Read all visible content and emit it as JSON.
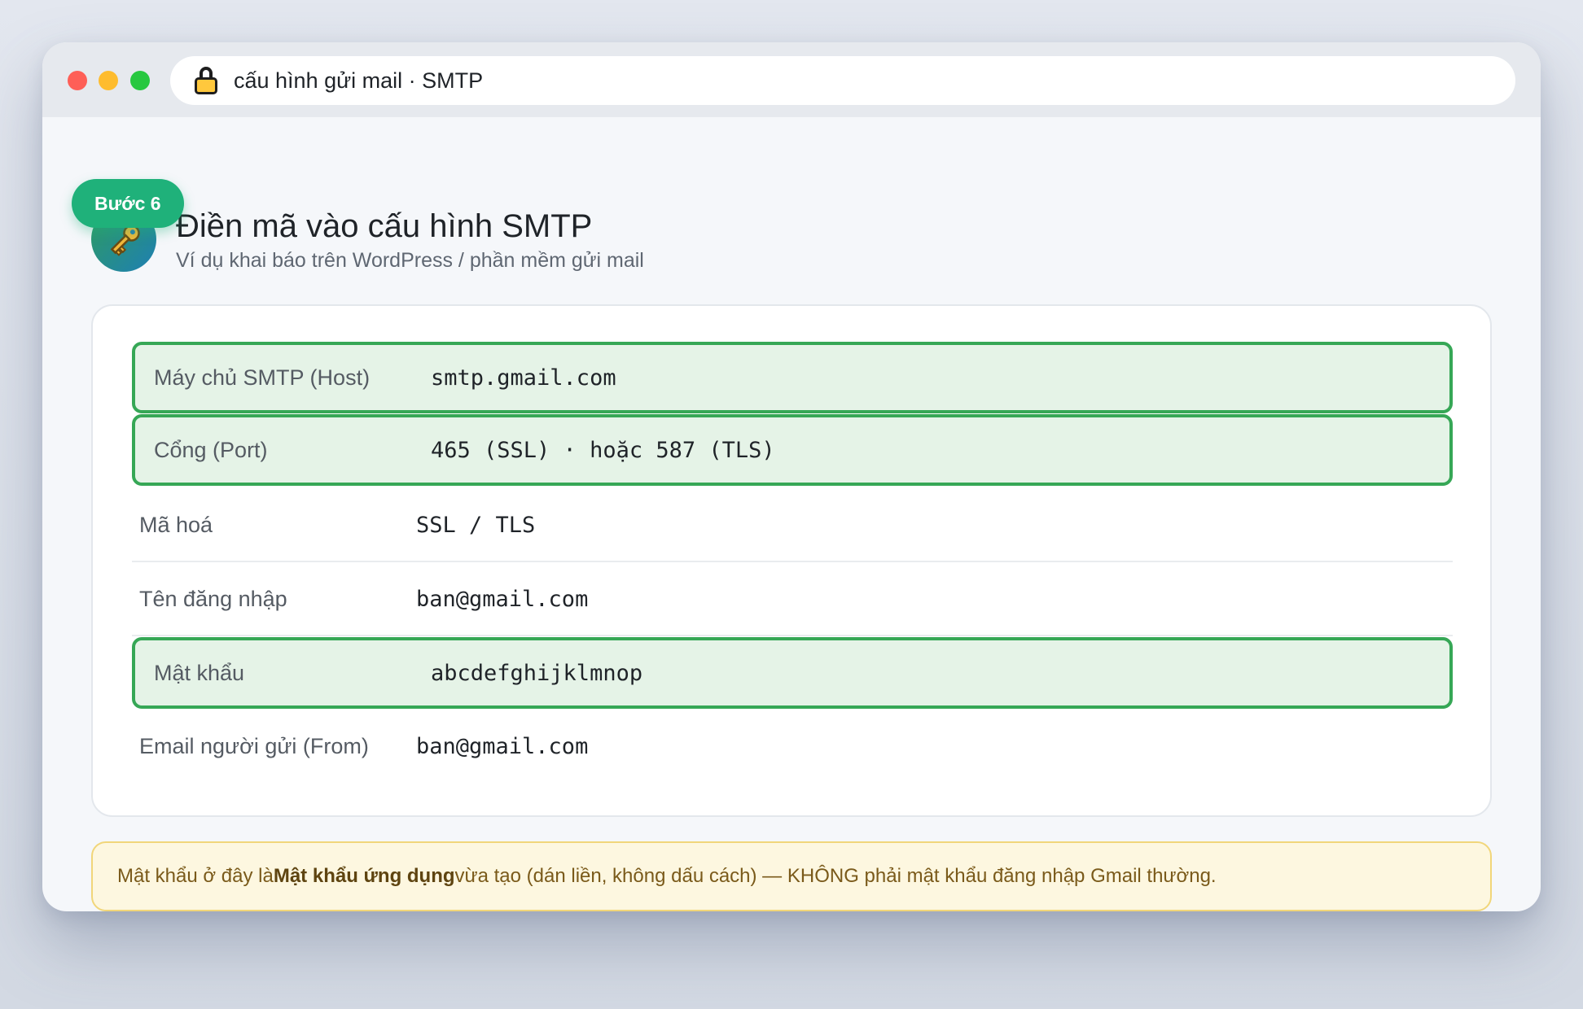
{
  "window": {
    "address_text": "cấu hình gửi mail · SMTP"
  },
  "header": {
    "step_badge": "Bước 6",
    "title": "Điền mã vào cấu hình SMTP",
    "subtitle": "Ví dụ khai báo trên WordPress / phần mềm gửi mail"
  },
  "settings": [
    {
      "label": "Máy chủ SMTP (Host)",
      "value": "smtp.gmail.com",
      "highlighted": true
    },
    {
      "label": "Cổng (Port)",
      "value": "465 (SSL) · hoặc 587 (TLS)",
      "highlighted": true
    },
    {
      "label": "Mã hoá",
      "value": "SSL / TLS",
      "highlighted": false
    },
    {
      "label": "Tên đăng nhập",
      "value": "ban@gmail.com",
      "highlighted": false
    },
    {
      "label": "Mật khẩu",
      "value": "abcdefghijklmnop",
      "highlighted": true
    },
    {
      "label": "Email người gửi (From)",
      "value": "ban@gmail.com",
      "highlighted": false
    }
  ],
  "note": {
    "prefix": "Mật khẩu ở đây là ",
    "bold": "Mật khẩu ứng dụng",
    "suffix": " vừa tạo (dán liền, không dấu cách) — KHÔNG phải mật khẩu đăng nhập Gmail thường."
  },
  "colors": {
    "badge": "#1fb17a",
    "highlight_border": "#36a756",
    "highlight_fill": "#e5f3e7",
    "note_fill": "#fdf7e0",
    "note_border": "#f1d67a"
  },
  "icons": {
    "address": "lock-icon",
    "header": "key-icon"
  }
}
